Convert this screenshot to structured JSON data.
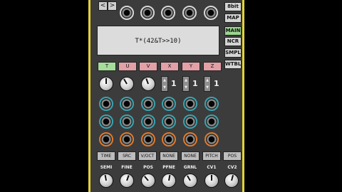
{
  "nav": {
    "prev": "<",
    "next": ">"
  },
  "side_buttons": [
    "8bit",
    "MAP",
    "MAIN",
    "NCR",
    "SMPL",
    "WTBL"
  ],
  "active_side": "MAIN",
  "display": {
    "expression": "T*(42&T>>10)"
  },
  "tabs": [
    "T",
    "U",
    "V",
    "X",
    "Y",
    "Z"
  ],
  "active_tab": "T",
  "steppers": [
    {
      "value": "1"
    },
    {
      "value": "1"
    },
    {
      "value": "1"
    }
  ],
  "modes": [
    "TIME",
    "SRC",
    "V/OCT",
    "NONE",
    "NONE",
    "PITCH",
    "POS"
  ],
  "knob_labels": [
    "SEMI",
    "FINE",
    "POS",
    "PFNE",
    "GRNL",
    "CV1",
    "CV2"
  ],
  "colors": {
    "rail": "#e2d23a",
    "active": "#a6dc9a",
    "tab": "#e3a0a6",
    "teal": "#39a4b0",
    "orange": "#e27a2c"
  }
}
